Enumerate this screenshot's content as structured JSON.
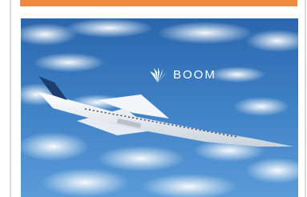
{
  "brand": {
    "name": "BOOM",
    "logo_icon": "boom-wings-logo"
  },
  "colors": {
    "accent_bar": "#f08a3e",
    "rail": "#dcdcdc",
    "sky_top": "#2f6fb5",
    "sky_bottom": "#5a9bd8",
    "cloud": "#e8f0f8"
  },
  "hero": {
    "image_subject": "supersonic-jet-over-clouds"
  }
}
